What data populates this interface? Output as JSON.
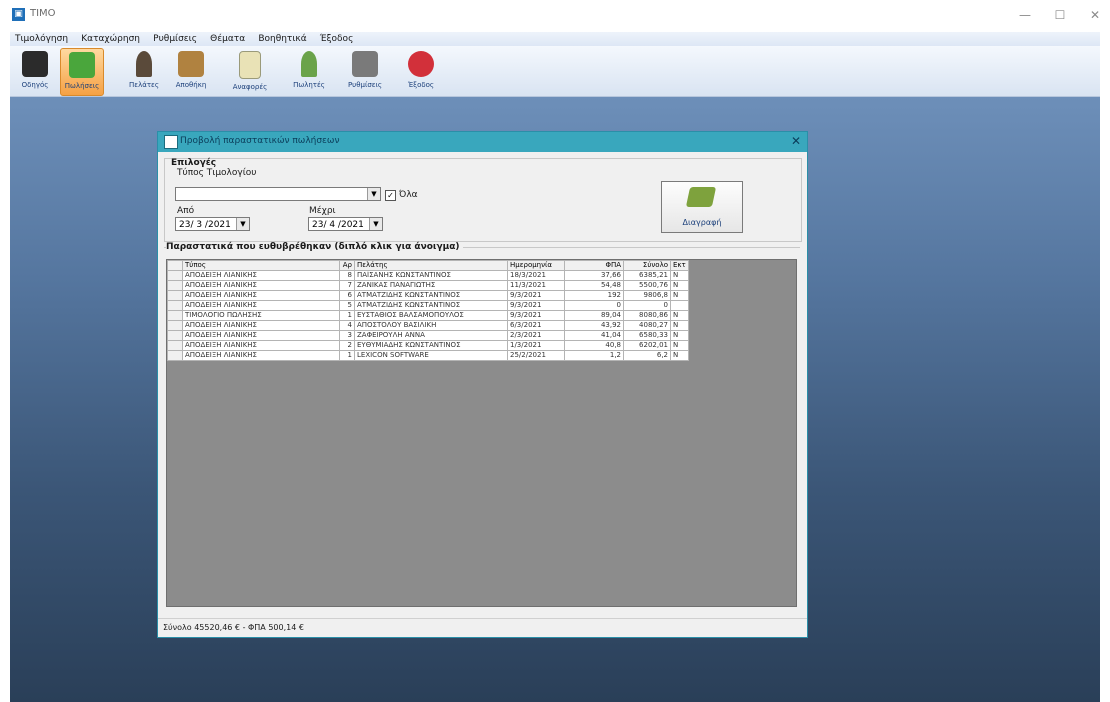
{
  "window": {
    "title": "ΤΙΜΟ",
    "app_icon": "app-icon",
    "min": "—",
    "max": "☐",
    "close": "✕"
  },
  "menu": [
    "Τιμολόγηση",
    "Καταχώρηση",
    "Ρυθμίσεις",
    "Θέματα",
    "Βοηθητικά",
    "Έξοδος"
  ],
  "toolbar": [
    {
      "label": "Οδηγός",
      "icon": "hat-icon",
      "color": "#2b2b2b"
    },
    {
      "label": "Πωλήσεις",
      "icon": "recycle-icon",
      "color": "#4aa63c"
    },
    {
      "label": "Πελάτες",
      "icon": "person-icon",
      "color": "#5a4a3a"
    },
    {
      "label": "Αποθήκη",
      "icon": "box-icon",
      "color": "#b08240"
    },
    {
      "label": "Αναφορές",
      "icon": "report-icon",
      "color": "#e9e2b6"
    },
    {
      "label": "Πωλητές",
      "icon": "seller-icon",
      "color": "#6aa34a"
    },
    {
      "label": "Ρυθμίσεις",
      "icon": "settings-icon",
      "color": "#7a7a7a"
    },
    {
      "label": "Έξοδος",
      "icon": "exit-icon",
      "color": "#d2303a"
    }
  ],
  "dialog": {
    "title": "Προβολή παραστατικών πωλήσεων",
    "close": "✕",
    "selection_label": "Επιλογές",
    "doc_type_label": "Τύπος Τιμολογίου",
    "doc_type_value": "",
    "all_label": "Όλα",
    "all_checked": "✓",
    "from_label": "Από",
    "from_value": "23/ 3 /2021",
    "to_label": "Μέχρι",
    "to_value": "23/ 4 /2021",
    "export_label": "Διαγραφή",
    "grid_label": "Παραστατικά που ευθυβρέθηκαν (διπλό κλικ για άνοιγμα)",
    "columns": [
      "Τύπος",
      "Αρ",
      "Πελάτης",
      "Ημερομηνία",
      "ΦΠΑ",
      "Σύνολο",
      "Εκτ"
    ],
    "rows": [
      [
        "ΑΠΟΔΕΙΞΗ ΛΙΑΝΙΚΗΣ",
        "8",
        "ΠΑΪΣΑΝΗΣ ΚΩΝΣΤΑΝΤΙΝΟΣ",
        "18/3/2021",
        "37,66",
        "6385,21",
        "Ν"
      ],
      [
        "ΑΠΟΔΕΙΞΗ ΛΙΑΝΙΚΗΣ",
        "7",
        "ΖΑΝΙΚΑΣ ΠΑΝΑΓΙΩΤΗΣ",
        "11/3/2021",
        "54,48",
        "5500,76",
        "Ν"
      ],
      [
        "ΑΠΟΔΕΙΞΗ ΛΙΑΝΙΚΗΣ",
        "6",
        "ΑΤΜΑΤΖΙΔΗΣ ΚΩΝΣΤΑΝΤΙΝΟΣ",
        "9/3/2021",
        "192",
        "9806,8",
        "Ν"
      ],
      [
        "ΑΠΟΔΕΙΞΗ ΛΙΑΝΙΚΗΣ",
        "5",
        "ΑΤΜΑΤΖΙΔΗΣ ΚΩΝΣΤΑΝΤΙΝΟΣ",
        "9/3/2021",
        "0",
        "0",
        ""
      ],
      [
        "ΤΙΜΟΛΟΓΙΟ ΠΩΛΗΣΗΣ",
        "1",
        "ΕΥΣΤΑΘΙΟΣ ΒΑΛΣΑΜΟΠΟΥΛΟΣ",
        "9/3/2021",
        "89,04",
        "8080,86",
        "Ν"
      ],
      [
        "ΑΠΟΔΕΙΞΗ ΛΙΑΝΙΚΗΣ",
        "4",
        "ΑΠΟΣΤΟΛΟΥ ΒΑΣΙΛΙΚΗ",
        "6/3/2021",
        "43,92",
        "4080,27",
        "Ν"
      ],
      [
        "ΑΠΟΔΕΙΞΗ ΛΙΑΝΙΚΗΣ",
        "3",
        "ΖΑΦΕΙΡΟΥΛΗ ΑΝΝΑ",
        "2/3/2021",
        "41,04",
        "6580,33",
        "Ν"
      ],
      [
        "ΑΠΟΔΕΙΞΗ ΛΙΑΝΙΚΗΣ",
        "2",
        "ΕΥΘΥΜΙΑΔΗΣ ΚΩΝΣΤΑΝΤΙΝΟΣ",
        "1/3/2021",
        "40,8",
        "6202,01",
        "Ν"
      ],
      [
        "ΑΠΟΔΕΙΞΗ ΛΙΑΝΙΚΗΣ",
        "1",
        "LEXICON SOFTWARE",
        "25/2/2021",
        "1,2",
        "6,2",
        "Ν"
      ]
    ],
    "status": "Σύνολο 45520,46 € - ΦΠΑ 500,14 €"
  }
}
